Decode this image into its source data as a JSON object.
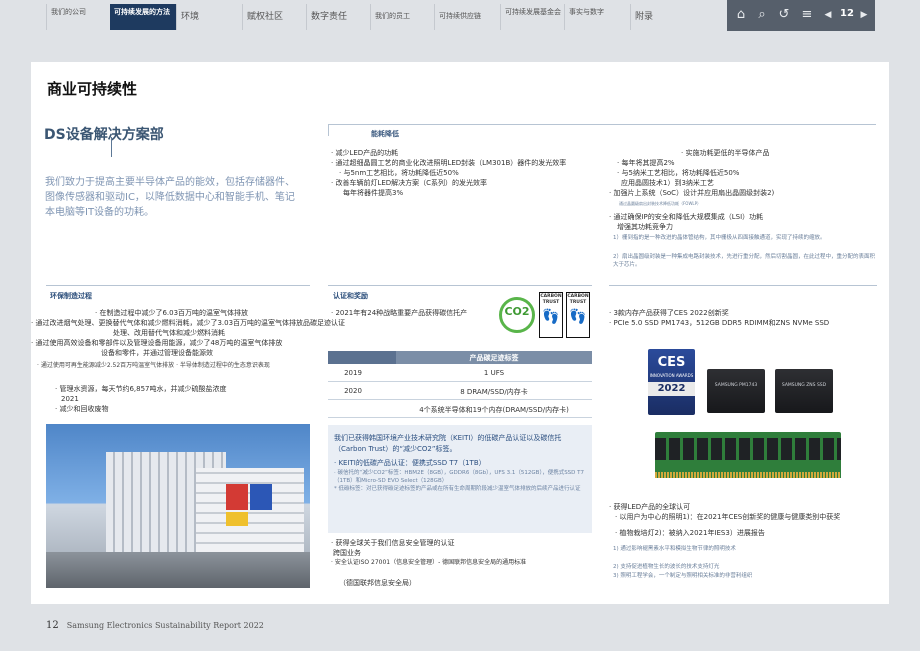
{
  "nav": {
    "tabs": [
      {
        "label": "我们的公司",
        "active": false
      },
      {
        "label": "可持续发展的方法",
        "active": true
      },
      {
        "label": "环境",
        "active": false
      },
      {
        "label": "赋权社区",
        "active": false
      },
      {
        "label": "数字责任",
        "active": false
      },
      {
        "label": "我们的员工",
        "active": false
      },
      {
        "label": "可持续供应链",
        "active": false
      },
      {
        "label": "可持续发展基金会",
        "active": false
      },
      {
        "label": "事实与数字",
        "active": false
      },
      {
        "label": "附录",
        "active": false
      }
    ],
    "toolbar": {
      "home_icon": "⌂",
      "search_icon": "⌕",
      "back_icon": "↺",
      "menu_icon": "≡",
      "prev_icon": "◀",
      "page_number": "12",
      "next_icon": "▶"
    }
  },
  "page": {
    "title": "商业可持续性",
    "section_title": "DS设备解决方案部",
    "intro": "我们致力于提高主要半导体产品的能效，包括存储器件、图像传感器和驱动IC，以降低数据中心和智能手机、笔记本电脑等IT设备的功耗。"
  },
  "energy": {
    "header": "能耗降低",
    "left": [
      "· 减少LED产品的功耗",
      "· 通过超细晶圆工艺的商业化改进照明LED封装（LM301B）器件的发光效率",
      "· 与5nm工艺相比，将功耗降低近50%",
      "· 改善车辆前灯LED解决方案（C系列）的发光效率",
      "每年将器件提高3%"
    ],
    "right": [
      "· 实施功耗更低的半导体产品",
      "· 每年将其提高2%",
      "· 与5纳米工艺相比，将功耗降低近50%",
      "应用晶圆技术1）到3纳米工艺",
      "· 加强片上系统（SoC）设计并应用扇出晶圆级封装2)",
      "通过晶圆级扇出封装技术降低功耗（FOWLP）",
      "· 通过确保IP的安全和降低大规模集成（LSI）功耗",
      "增强其功耗竞争力",
      "1）栅到指的是一种改进的晶体管结构，其中栅极从四面接触通道，实现了持续的缩放。",
      "2）扇出晶圆级封装是一种集成电路封装技术，先进行重分配，然后切割晶圆，在此过程中，重分配的表面积大于芯片。"
    ]
  },
  "eco_process": {
    "header": "环保制造过程",
    "lines": [
      "· 在制造过程中减少了6.03百万吨的温室气体排放",
      "· 通过改进烟气处理、更换替代气体和减少燃料消耗，减少了3.03百万吨的温室气体排放品碳足迹认证",
      "处理、改用替代气体和减少燃料消耗",
      "· 通过使用高效设备和零部件以及管理设备用能源，减少了48万吨的温室气体排放",
      "设备和零件，并通过管理设备能源效",
      "· 通过使用可再生能源减少2.52百万吨温室气体排放 · 半导体制造过程中的生态意识表现",
      "· 管理水资源，每天节约6,857吨水，并减少硫酸盐浓度",
      "2021",
      "· 减少和回收废物"
    ]
  },
  "certification": {
    "header": "认证和奖励",
    "line1": "· 2021年有24种战略重要产品获得碳信托产",
    "co2_label": "CO2",
    "trust_label": "CARBON TRUST",
    "footprint_icon": "👣",
    "table": {
      "title": "产品碳足迹标签",
      "rows": [
        {
          "year": "2019",
          "products": "1 UFS"
        },
        {
          "year": "2020",
          "products": "8 DRAM/SSD/内存卡"
        },
        {
          "year": "",
          "products": "4个系统半导体和19个内存(DRAM/SSD/内存卡)"
        }
      ]
    },
    "box": {
      "p1": "我们已获得韩国环境产业技术研究院（KEITI）的低碳产品认证以及碳信托（Carbon Trust）的“减少CO2”标签。",
      "p2": "· KEITI的低碳产品认证：便携式SSD T7（1TB）",
      "p3": "· 碳信托的“减少CO2”标签：HBM2E（8GB），GDDR6（8Gb），UFS 3.1（512GB），便携式SSD T7（1TB）和Micro-SD EVO Select（128GB）",
      "p4": "* 低碳标签：对已获得碳足迹标签的产品或在所有生命周期阶段减少温室气体排放的后续产品进行认证"
    },
    "iso_lines": [
      "· 获得全球关于我们信息安全管理的认证",
      "跨国业务",
      "· 安全认证ISO 27001（信息安全管理）- 德国联邦信息安全局的通用标准",
      "（德国联邦信息安全局）"
    ]
  },
  "awards": {
    "lines_top": [
      "· 3款内存产品获得了CES 2022创新奖",
      "· PCIe 5.0 SSD PM1743，512GB DDR5 RDIMM和ZNS NVMe SSD"
    ],
    "ces": {
      "brand": "CES",
      "text": "INNOVATION AWARDS",
      "year": "2022"
    },
    "ssd1": "SAMSUNG PM1743",
    "ssd2": "SAMSUNG ZNS SSD",
    "lines_bottom": [
      "· 获得LED产品的全球认可",
      "· 以用户为中心的照明1)：在2021年CES创新奖的健康与健康类别中获奖",
      "· 植物栽培灯2)：被纳入2021年IES3）进展报告",
      "1) 通过影响褪黑素水平和模拟生物节律的照明技术",
      "2) 支持促进植物生长的波长的技术支持灯光",
      "3) 照明工程学会，一个制定与照明相关标准的非营利组织"
    ]
  },
  "footer": {
    "page": "12",
    "text": "Samsung Electronics Sustainability Report 2022"
  }
}
